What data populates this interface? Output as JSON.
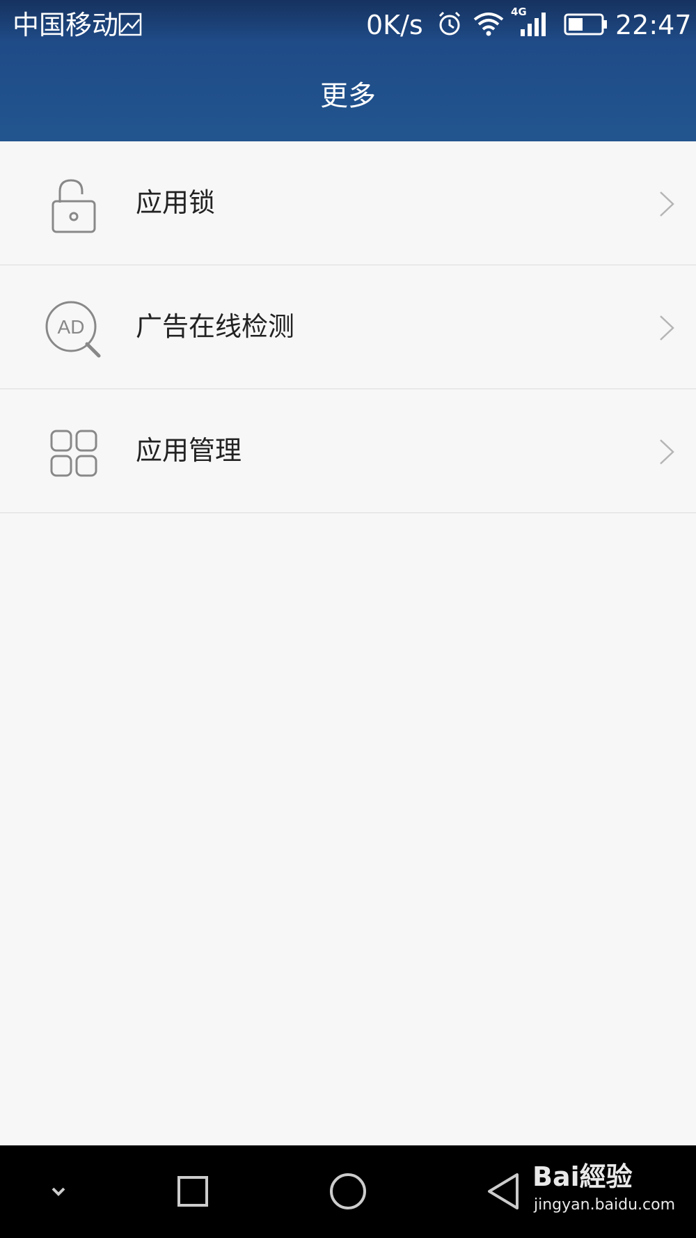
{
  "status_bar": {
    "carrier": "中国移动",
    "net_speed": "0K/s",
    "network_type": "4G",
    "time": "22:47",
    "icons": [
      "gallery-icon",
      "alarm-icon",
      "wifi-icon",
      "signal-icon",
      "battery-icon"
    ]
  },
  "header": {
    "title": "更多",
    "background_color": "#22558f"
  },
  "menu": {
    "items": [
      {
        "label": "应用锁",
        "icon": "unlocked-padlock-icon"
      },
      {
        "label": "广告在线检测",
        "icon": "ad-search-icon"
      },
      {
        "label": "应用管理",
        "icon": "app-grid-icon"
      }
    ]
  },
  "nav_bar": {
    "buttons": [
      "collapse-chevron-icon",
      "recent-apps-icon",
      "home-icon",
      "back-icon"
    ]
  },
  "watermark": {
    "logo": "Bai經验",
    "url": "jingyan.baidu.com"
  }
}
